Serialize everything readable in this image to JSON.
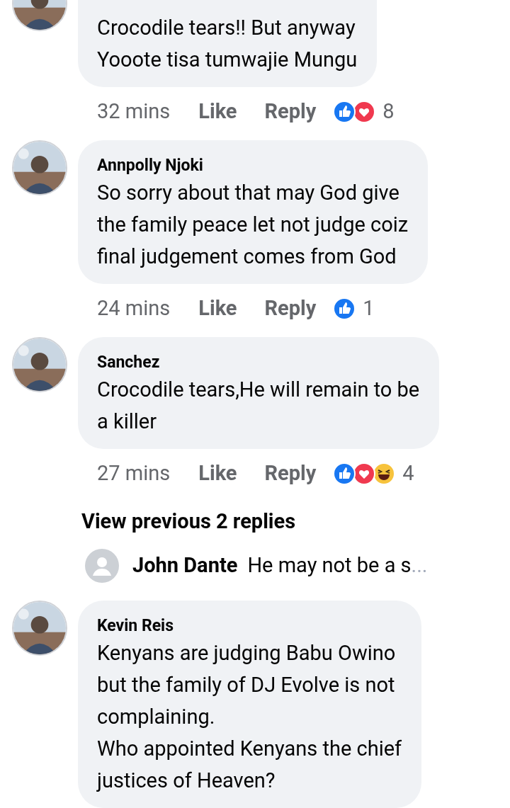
{
  "comments": [
    {
      "avatar": {
        "kind": "picture"
      },
      "lines": [
        "Crocodile tears!! But anyway",
        "Yooote tisa tumwajie Mungu"
      ],
      "time": "32 mins",
      "like": "Like",
      "reply": "Reply",
      "reactions": [
        {
          "kind": "like"
        },
        {
          "kind": "love"
        }
      ],
      "count": "8"
    },
    {
      "avatar": {
        "kind": "picture"
      },
      "name": "Annpolly Njoki",
      "lines": [
        "So sorry about that may God give",
        "the family peace let not judge coiz",
        "final judgement comes from God"
      ],
      "time": "24 mins",
      "like": "Like",
      "reply": "Reply",
      "reactions": [
        {
          "kind": "like"
        }
      ],
      "count": "1"
    },
    {
      "avatar": {
        "kind": "picture"
      },
      "name": "Sanchez",
      "lines": [
        "Crocodile tears,He will remain to be",
        "a killer"
      ],
      "time": "27 mins",
      "like": "Like",
      "reply": "Reply",
      "reactions": [
        {
          "kind": "like"
        },
        {
          "kind": "love"
        },
        {
          "kind": "haha"
        }
      ],
      "count": "4"
    },
    {
      "kind": "more",
      "label": "View previous 2 replies"
    },
    {
      "kind": "reply_preview",
      "avatar": {
        "kind": "default"
      },
      "name": "John Dante",
      "text": "He may not be a s",
      "ellipsis": "..."
    },
    {
      "avatar": {
        "kind": "picture"
      },
      "name": "Kevin Reis",
      "lines": [
        "Kenyans are judging Babu Owino",
        "but the family of DJ Evolve is not",
        "complaining.",
        "Who appointed Kenyans the chief",
        "justices of Heaven?"
      ]
    }
  ]
}
